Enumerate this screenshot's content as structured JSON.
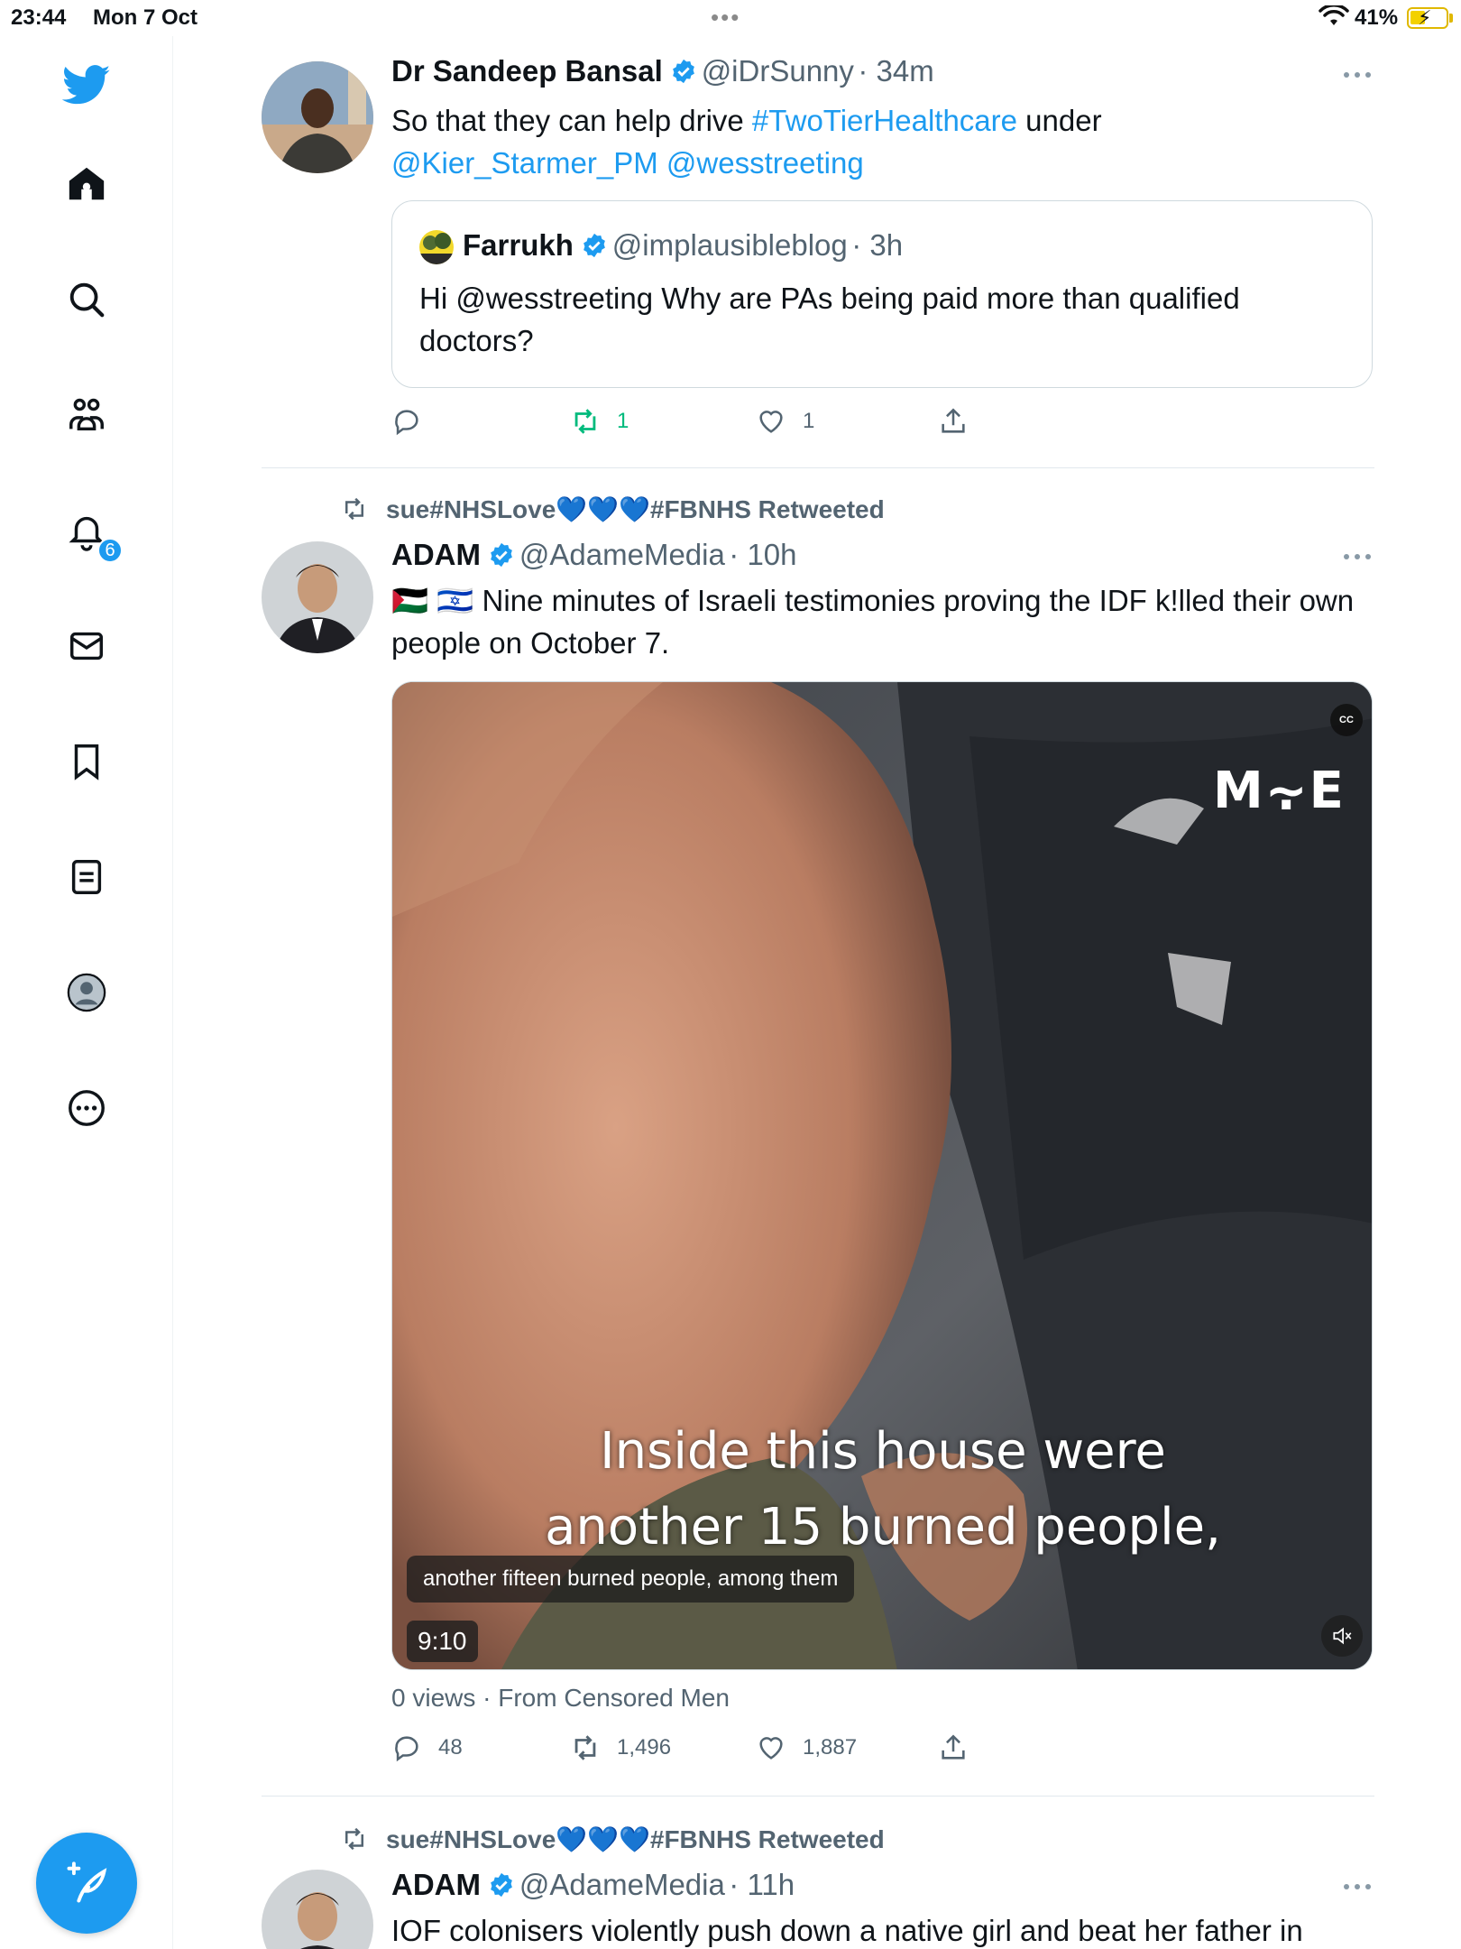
{
  "status_bar": {
    "time": "23:44",
    "date": "Mon 7 Oct",
    "battery": "41%"
  },
  "sidebar": {
    "items": [
      {
        "name": "home",
        "icon": "home-icon"
      },
      {
        "name": "explore",
        "icon": "search-icon"
      },
      {
        "name": "communities",
        "icon": "communities-icon"
      },
      {
        "name": "notifications",
        "icon": "bell-icon",
        "badge": "6"
      },
      {
        "name": "messages",
        "icon": "mail-icon"
      },
      {
        "name": "bookmarks",
        "icon": "bookmark-icon"
      },
      {
        "name": "lists",
        "icon": "lists-icon"
      },
      {
        "name": "profile",
        "icon": "profile-icon"
      },
      {
        "name": "more",
        "icon": "more-circle-icon"
      }
    ],
    "accent": "#1d9bf0"
  },
  "tweets": [
    {
      "name": "Dr Sandeep Bansal",
      "handle": "@iDrSunny",
      "time": "· 34m",
      "text_plain": "So that they can help drive ",
      "hashtag": "#TwoTierHealthcare",
      "text_after": " under",
      "mention1": "@Kier_Starmer_PM",
      "mention2": "@wesstreeting",
      "quote": {
        "name": "Farrukh",
        "handle": "@implausibleblog",
        "time": "· 3h",
        "text": "Hi @wesstreeting Why are PAs being paid more than qualified doctors?"
      },
      "actions": {
        "replies": "",
        "retweets": "1",
        "likes": "1"
      }
    },
    {
      "retweeted_by": "sue#NHSLove💙💙💙#FBNHS Retweeted",
      "name": "ADAM",
      "handle": "@AdameMedia",
      "time": "· 10h",
      "flags": "🇵🇸 🇮🇱",
      "text": " Nine minutes of Israeli testimonies proving the IDF k!lled their own people on October 7.",
      "video": {
        "caption_line1": "Inside this house were",
        "caption_line2": "another 15 burned people,",
        "subtitle": "another fifteen burned people, among them",
        "duration": "9:10",
        "watermark": "M⸟E",
        "cc": "CC"
      },
      "views": "0 views · From Censored Men",
      "actions": {
        "replies": "48",
        "retweets": "1,496",
        "likes": "1,887"
      }
    },
    {
      "retweeted_by": "sue#NHSLove💙💙💙#FBNHS Retweeted",
      "name": "ADAM",
      "handle": "@AdameMedia",
      "time": "· 11h",
      "text": "IOF colonisers violently push down a native girl and beat her father in"
    }
  ]
}
